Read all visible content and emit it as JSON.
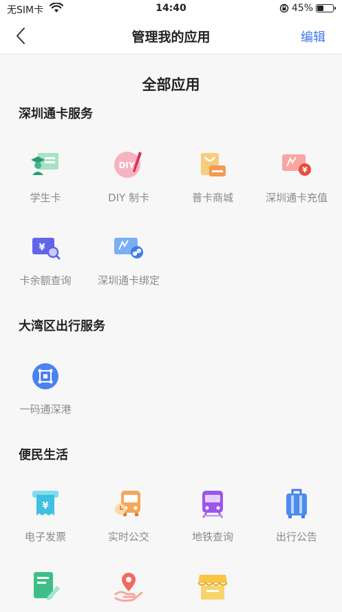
{
  "status_bar": {
    "carrier": "无SIM卡",
    "time": "14:40",
    "battery": "45%",
    "battery_level": 0.45
  },
  "header": {
    "title": "管理我的应用",
    "edit_label": "编辑"
  },
  "main": {
    "heading": "全部应用"
  },
  "sections": [
    {
      "title": "深圳通卡服务",
      "items": [
        {
          "label": "学生卡",
          "icon": "student-card-icon"
        },
        {
          "label": "DIY 制卡",
          "icon": "diy-card-icon"
        },
        {
          "label": "普卡商城",
          "icon": "shopping-bag-icon"
        },
        {
          "label": "深圳通卡充值",
          "icon": "card-recharge-icon"
        },
        {
          "label": "卡余额查询",
          "icon": "balance-search-icon"
        },
        {
          "label": "深圳通卡绑定",
          "icon": "card-link-icon"
        }
      ]
    },
    {
      "title": "大湾区出行服务",
      "items": [
        {
          "label": "一码通深港",
          "icon": "qr-code-icon"
        }
      ]
    },
    {
      "title": "便民生活",
      "items": [
        {
          "label": "电子发票",
          "icon": "invoice-icon"
        },
        {
          "label": "实时公交",
          "icon": "bus-icon"
        },
        {
          "label": "地铁查询",
          "icon": "metro-icon"
        },
        {
          "label": "出行公告",
          "icon": "luggage-icon"
        },
        {
          "label": "",
          "icon": "edit-document-icon"
        },
        {
          "label": "",
          "icon": "location-hand-icon"
        },
        {
          "label": "",
          "icon": "shop-icon"
        }
      ]
    }
  ],
  "colors": {
    "accent": "#3b78e7"
  }
}
